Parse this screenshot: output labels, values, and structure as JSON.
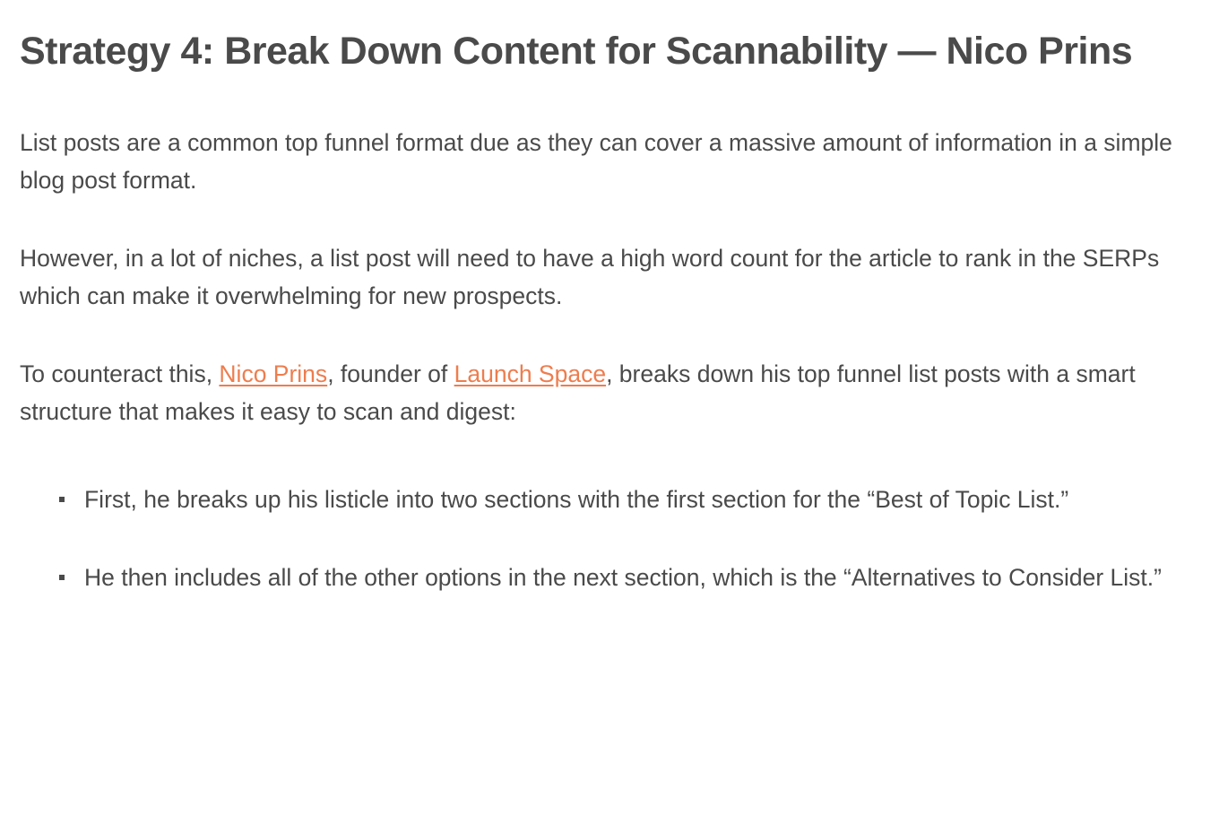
{
  "heading": "Strategy 4: Break Down Content for Scannability — Nico Prins",
  "paragraphs": {
    "p1": "List posts are a common top funnel format due as they can cover a massive amount of information in a simple blog post format.",
    "p2": "However, in a lot of niches, a list post will need to have a high word count for the article to rank in the SERPs which can make it overwhelming for new prospects.",
    "p3_part1": "To counteract this, ",
    "p3_link1": "Nico Prins",
    "p3_part2": ", founder of ",
    "p3_link2": "Launch Space",
    "p3_part3": ", breaks down his top funnel list posts with a smart structure that makes it easy to scan and digest:"
  },
  "list_items": {
    "item1": "First, he breaks up his listicle into two sections with the first section for the “Best of Topic List.”",
    "item2": "He then includes all of the other options in the next section, which is the “Alternatives to Consider List.”"
  }
}
